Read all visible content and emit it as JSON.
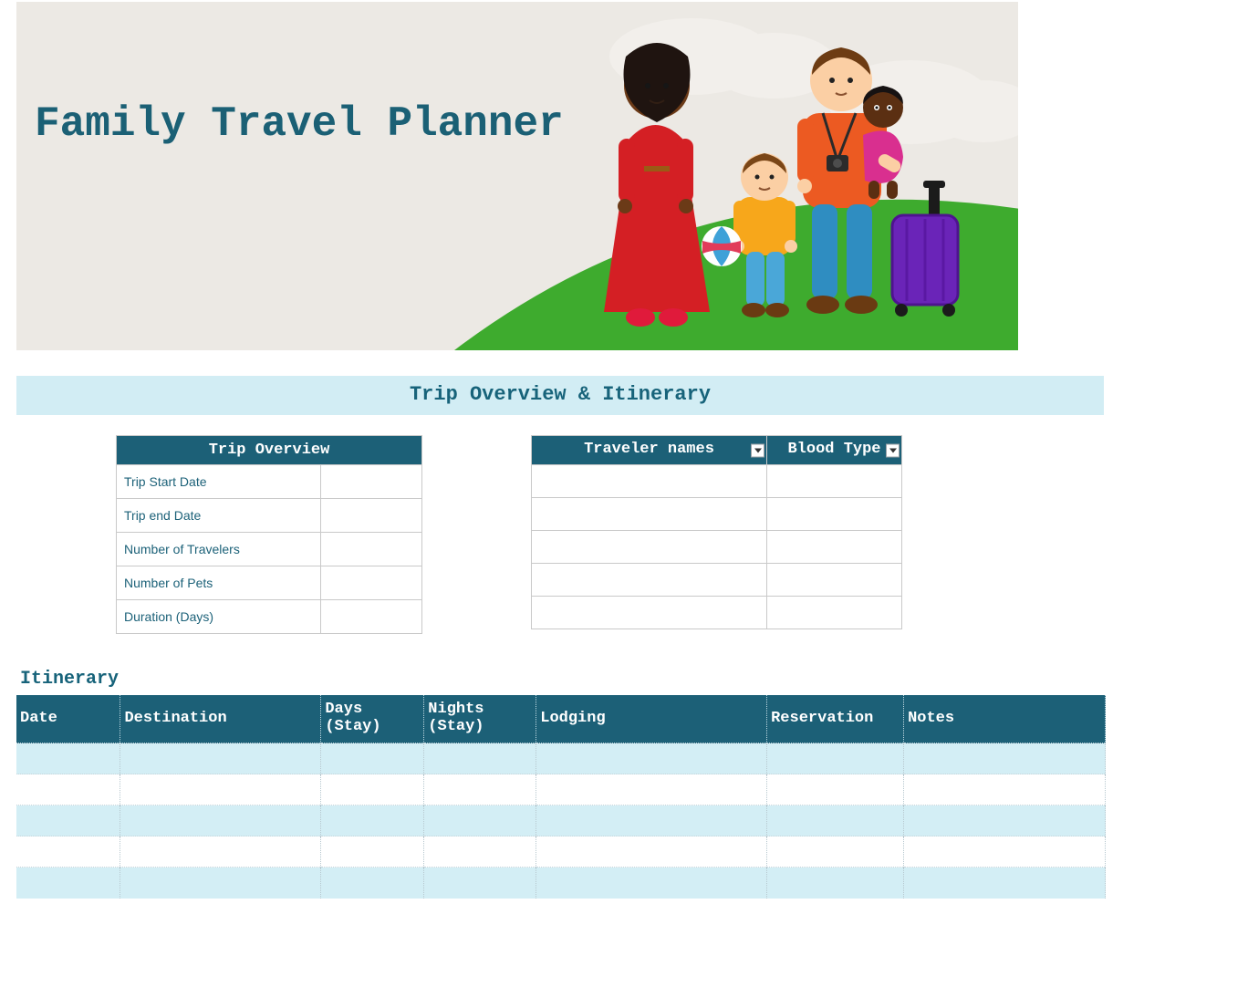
{
  "hero": {
    "title": "Family Travel Planner"
  },
  "section_bar": "Trip Overview & Itinerary",
  "overview": {
    "header": "Trip Overview",
    "rows": [
      {
        "label": "Trip Start Date",
        "value": ""
      },
      {
        "label": "Trip end Date",
        "value": ""
      },
      {
        "label": "Number of Travelers",
        "value": ""
      },
      {
        "label": "Number of Pets",
        "value": ""
      },
      {
        "label": "Duration (Days)",
        "value": ""
      }
    ]
  },
  "travelers": {
    "col1": "Traveler names",
    "col2": "Blood Type",
    "rows": [
      {
        "name": "",
        "blood": ""
      },
      {
        "name": "",
        "blood": ""
      },
      {
        "name": "",
        "blood": ""
      },
      {
        "name": "",
        "blood": ""
      },
      {
        "name": "",
        "blood": ""
      }
    ]
  },
  "itinerary": {
    "title": "Itinerary",
    "cols": {
      "c0": "Date",
      "c1": "Destination",
      "c2": "Days (Stay)",
      "c3": "Nights (Stay)",
      "c4": "Lodging",
      "c5": "Reservation",
      "c6": "Notes"
    },
    "rows": [
      {
        "c0": "",
        "c1": "",
        "c2": "",
        "c3": "",
        "c4": "",
        "c5": "",
        "c6": ""
      },
      {
        "c0": "",
        "c1": "",
        "c2": "",
        "c3": "",
        "c4": "",
        "c5": "",
        "c6": ""
      },
      {
        "c0": "",
        "c1": "",
        "c2": "",
        "c3": "",
        "c4": "",
        "c5": "",
        "c6": ""
      },
      {
        "c0": "",
        "c1": "",
        "c2": "",
        "c3": "",
        "c4": "",
        "c5": "",
        "c6": ""
      },
      {
        "c0": "",
        "c1": "",
        "c2": "",
        "c3": "",
        "c4": "",
        "c5": "",
        "c6": ""
      }
    ]
  },
  "colors": {
    "teal": "#1c6077",
    "lightblue": "#d3eef5"
  }
}
